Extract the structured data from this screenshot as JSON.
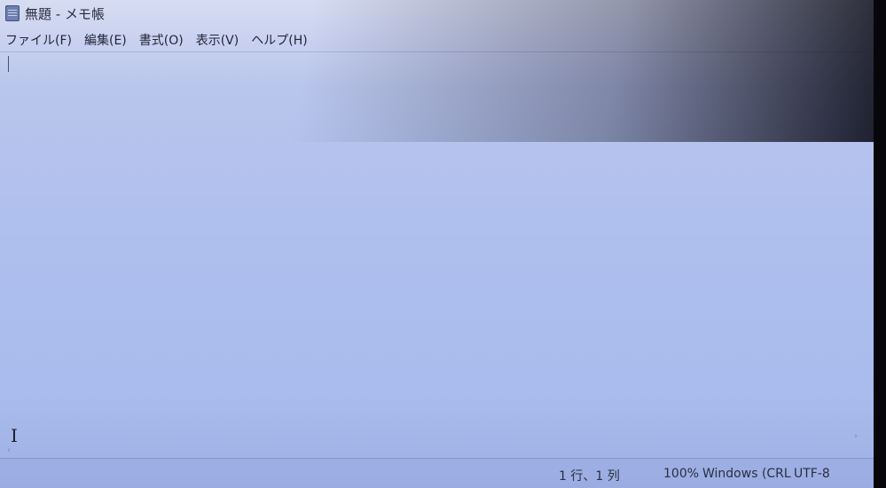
{
  "window": {
    "title": "無題 - メモ帳"
  },
  "menu": {
    "items": [
      {
        "label": "ファイル(F)"
      },
      {
        "label": "編集(E)"
      },
      {
        "label": "書式(O)"
      },
      {
        "label": "表示(V)"
      },
      {
        "label": "ヘルプ(H)"
      }
    ]
  },
  "editor": {
    "content": ""
  },
  "statusbar": {
    "position": "1 行、1 列",
    "zoom": "100%",
    "line_ending": "Windows (CRL",
    "encoding": "UTF-8"
  },
  "icons": {
    "app": "notepad-icon",
    "cursor": "i-beam-cursor-icon",
    "scroll_left": "chevron-left-icon",
    "scroll_right": "chevron-right-icon"
  }
}
